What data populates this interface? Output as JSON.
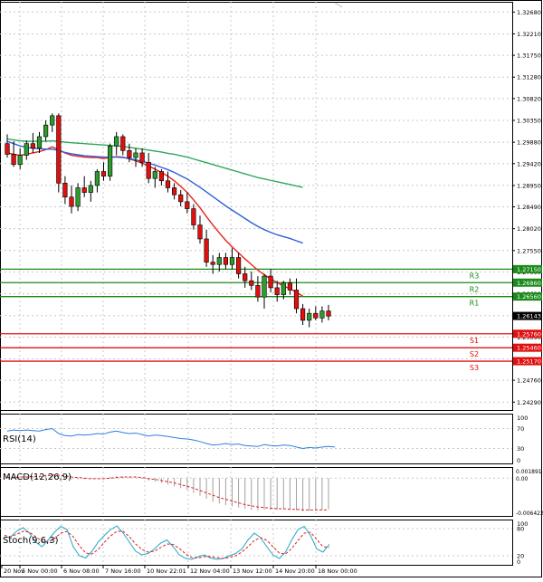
{
  "chart_data": [
    {
      "type": "candlestick",
      "symbol": "GBPUSD",
      "x_tick_labels": [
        "20 Nov",
        "5 Nov 00:00",
        "6 Nov 08:00",
        "7 Nov 16:00",
        "10 Nov 22:01",
        "12 Nov 04:00",
        "13 Nov 12:00",
        "14 Nov 20:00",
        "18 Nov 00:00"
      ],
      "y_tick_labels": [
        "1.32680",
        "1.32210",
        "1.31750",
        "1.31280",
        "1.30820",
        "1.30350",
        "1.29880",
        "1.29420",
        "1.28950",
        "1.28490",
        "1.28020",
        "1.27550",
        "1.27090",
        "1.26620",
        "1.26150",
        "1.25690",
        "1.25220",
        "1.24760",
        "1.24290"
      ],
      "ylim": [
        1.2412,
        1.329
      ],
      "current_price": "1.26143",
      "candles": [
        {
          "o": 1.2985,
          "h": 1.3005,
          "l": 1.2955,
          "c": 1.2962
        },
        {
          "o": 1.2962,
          "h": 1.299,
          "l": 1.2935,
          "c": 1.294
        },
        {
          "o": 1.294,
          "h": 1.2975,
          "l": 1.293,
          "c": 1.296
        },
        {
          "o": 1.296,
          "h": 1.2992,
          "l": 1.295,
          "c": 1.2985
        },
        {
          "o": 1.2985,
          "h": 1.3008,
          "l": 1.2965,
          "c": 1.2975
        },
        {
          "o": 1.2975,
          "h": 1.301,
          "l": 1.2965,
          "c": 1.3
        },
        {
          "o": 1.3,
          "h": 1.3035,
          "l": 1.299,
          "c": 1.3025
        },
        {
          "o": 1.3025,
          "h": 1.305,
          "l": 1.301,
          "c": 1.3045
        },
        {
          "o": 1.3045,
          "h": 1.305,
          "l": 1.288,
          "c": 1.29
        },
        {
          "o": 1.29,
          "h": 1.2915,
          "l": 1.2855,
          "c": 1.287
        },
        {
          "o": 1.287,
          "h": 1.2895,
          "l": 1.2835,
          "c": 1.285
        },
        {
          "o": 1.285,
          "h": 1.29,
          "l": 1.284,
          "c": 1.289
        },
        {
          "o": 1.289,
          "h": 1.2915,
          "l": 1.287,
          "c": 1.288
        },
        {
          "o": 1.288,
          "h": 1.2905,
          "l": 1.286,
          "c": 1.2895
        },
        {
          "o": 1.2895,
          "h": 1.293,
          "l": 1.288,
          "c": 1.2925
        },
        {
          "o": 1.2925,
          "h": 1.2945,
          "l": 1.2905,
          "c": 1.2915
        },
        {
          "o": 1.2915,
          "h": 1.2985,
          "l": 1.2905,
          "c": 1.298
        },
        {
          "o": 1.298,
          "h": 1.301,
          "l": 1.296,
          "c": 1.3
        },
        {
          "o": 1.3,
          "h": 1.3005,
          "l": 1.296,
          "c": 1.297
        },
        {
          "o": 1.297,
          "h": 1.2985,
          "l": 1.2945,
          "c": 1.2955
        },
        {
          "o": 1.2955,
          "h": 1.2975,
          "l": 1.2935,
          "c": 1.2965
        },
        {
          "o": 1.2965,
          "h": 1.2975,
          "l": 1.2935,
          "c": 1.2945
        },
        {
          "o": 1.2945,
          "h": 1.2965,
          "l": 1.29,
          "c": 1.291
        },
        {
          "o": 1.291,
          "h": 1.2935,
          "l": 1.289,
          "c": 1.2925
        },
        {
          "o": 1.2925,
          "h": 1.293,
          "l": 1.2895,
          "c": 1.2905
        },
        {
          "o": 1.2905,
          "h": 1.2925,
          "l": 1.288,
          "c": 1.289
        },
        {
          "o": 1.289,
          "h": 1.29,
          "l": 1.2865,
          "c": 1.2875
        },
        {
          "o": 1.2875,
          "h": 1.2885,
          "l": 1.285,
          "c": 1.286
        },
        {
          "o": 1.286,
          "h": 1.288,
          "l": 1.2835,
          "c": 1.2845
        },
        {
          "o": 1.2845,
          "h": 1.2855,
          "l": 1.28,
          "c": 1.281
        },
        {
          "o": 1.281,
          "h": 1.283,
          "l": 1.277,
          "c": 1.278
        },
        {
          "o": 1.278,
          "h": 1.28,
          "l": 1.272,
          "c": 1.273
        },
        {
          "o": 1.273,
          "h": 1.2745,
          "l": 1.2705,
          "c": 1.2725
        },
        {
          "o": 1.2725,
          "h": 1.275,
          "l": 1.271,
          "c": 1.274
        },
        {
          "o": 1.274,
          "h": 1.275,
          "l": 1.2715,
          "c": 1.2725
        },
        {
          "o": 1.2725,
          "h": 1.276,
          "l": 1.2715,
          "c": 1.274
        },
        {
          "o": 1.274,
          "h": 1.275,
          "l": 1.2695,
          "c": 1.2705
        },
        {
          "o": 1.2705,
          "h": 1.272,
          "l": 1.2675,
          "c": 1.269
        },
        {
          "o": 1.269,
          "h": 1.271,
          "l": 1.267,
          "c": 1.268
        },
        {
          "o": 1.268,
          "h": 1.27,
          "l": 1.2645,
          "c": 1.2655
        },
        {
          "o": 1.2655,
          "h": 1.2705,
          "l": 1.263,
          "c": 1.27
        },
        {
          "o": 1.27,
          "h": 1.2715,
          "l": 1.2665,
          "c": 1.2675
        },
        {
          "o": 1.2675,
          "h": 1.269,
          "l": 1.2645,
          "c": 1.266
        },
        {
          "o": 1.266,
          "h": 1.269,
          "l": 1.265,
          "c": 1.2685
        },
        {
          "o": 1.2685,
          "h": 1.2695,
          "l": 1.266,
          "c": 1.267
        },
        {
          "o": 1.267,
          "h": 1.2695,
          "l": 1.262,
          "c": 1.263
        },
        {
          "o": 1.263,
          "h": 1.264,
          "l": 1.2595,
          "c": 1.2605
        },
        {
          "o": 1.2605,
          "h": 1.263,
          "l": 1.259,
          "c": 1.262
        },
        {
          "o": 1.262,
          "h": 1.2635,
          "l": 1.2605,
          "c": 1.261
        },
        {
          "o": 1.261,
          "h": 1.2635,
          "l": 1.26,
          "c": 1.2625
        },
        {
          "o": 1.2625,
          "h": 1.2638,
          "l": 1.2605,
          "c": 1.2614
        }
      ],
      "moving_averages": [
        {
          "color": "#e8231c",
          "points": [
            1.2965,
            1.2962,
            1.296,
            1.2962,
            1.2965,
            1.2968,
            1.2972,
            1.2978,
            1.2972,
            1.2965,
            1.296,
            1.2958,
            1.2956,
            1.2955,
            1.2955,
            1.2953,
            1.2955,
            1.2957,
            1.2956,
            1.2952,
            1.2948,
            1.2943,
            1.2937,
            1.293,
            1.2923,
            1.2915,
            1.2905,
            1.2893,
            1.288,
            1.2864,
            1.2847,
            1.2828,
            1.281,
            1.2793,
            1.2777,
            1.2763,
            1.275,
            1.2737,
            1.2725,
            1.2713,
            1.2703,
            1.2694,
            1.2686,
            1.2679,
            1.2673,
            1.2665,
            1.2657
          ]
        },
        {
          "color": "#3060d8",
          "points": [
            1.299,
            1.2985,
            1.298,
            1.2977,
            1.2975,
            1.2974,
            1.2973,
            1.2973,
            1.297,
            1.2966,
            1.2963,
            1.2961,
            1.2959,
            1.2958,
            1.2957,
            1.2956,
            1.2956,
            1.2956,
            1.2955,
            1.2953,
            1.295,
            1.2947,
            1.2943,
            1.2939,
            1.2934,
            1.2929,
            1.2923,
            1.2916,
            1.2909,
            1.29,
            1.2891,
            1.2881,
            1.2871,
            1.2861,
            1.2851,
            1.2842,
            1.2833,
            1.2824,
            1.2815,
            1.2807,
            1.28,
            1.2794,
            1.2789,
            1.2785,
            1.2781,
            1.2776,
            1.2771
          ]
        },
        {
          "color": "#2fa85a",
          "points": [
            1.2995,
            1.2993,
            1.2991,
            1.299,
            1.299,
            1.299,
            1.299,
            1.2991,
            1.299,
            1.2988,
            1.2987,
            1.2986,
            1.2985,
            1.2984,
            1.2983,
            1.2982,
            1.2981,
            1.298,
            1.2979,
            1.2977,
            1.2975,
            1.2973,
            1.2971,
            1.2969,
            1.2967,
            1.2964,
            1.2962,
            1.2959,
            1.2956,
            1.2952,
            1.2948,
            1.2944,
            1.294,
            1.2936,
            1.2932,
            1.2928,
            1.2924,
            1.292,
            1.2916,
            1.2912,
            1.2909,
            1.2906,
            1.2903,
            1.29,
            1.2897,
            1.2894,
            1.2891
          ]
        }
      ],
      "levels": [
        {
          "name": "R3",
          "value": 1.2715,
          "label": "1.27150",
          "color": "#1a8a1a"
        },
        {
          "name": "R2",
          "value": 1.2686,
          "label": "1.26860",
          "color": "#1a8a1a"
        },
        {
          "name": "R1",
          "value": 1.2656,
          "label": "1.26560",
          "color": "#1a8a1a"
        },
        {
          "name": "S1",
          "value": 1.2576,
          "label": "1.25760",
          "color": "#e01010"
        },
        {
          "name": "S2",
          "value": 1.2546,
          "label": "1.25460",
          "color": "#e01010"
        },
        {
          "name": "S3",
          "value": 1.2517,
          "label": "1.25170",
          "color": "#e01010"
        }
      ]
    },
    {
      "type": "line",
      "title": "RSI(14)",
      "y_tick_labels": [
        "100",
        "70",
        "30",
        "0"
      ],
      "ylim": [
        0,
        100
      ],
      "levels": [
        70,
        30
      ],
      "values": [
        65,
        67,
        66,
        67,
        66,
        65,
        68,
        70,
        60,
        56,
        55,
        58,
        57,
        58,
        60,
        59,
        63,
        65,
        62,
        60,
        61,
        58,
        55,
        57,
        56,
        54,
        52,
        50,
        49,
        47,
        44,
        40,
        37,
        38,
        40,
        38,
        39,
        36,
        35,
        34,
        38,
        36,
        35,
        37,
        36,
        33,
        30,
        32,
        31,
        33,
        34,
        33
      ]
    },
    {
      "type": "histogram",
      "title": "MACD(12,26,9)",
      "y_tick_labels": [
        "0.001891",
        "0.00",
        "-0.006422"
      ],
      "ylim": [
        -0.006422,
        0.001891
      ],
      "histogram": [
        0.0004,
        0.0003,
        0.0002,
        0.0002,
        0.0003,
        0.0004,
        0.0006,
        0.0008,
        0.0004,
        0.0,
        -0.0002,
        -0.0002,
        -0.0002,
        -0.0001,
        0.0,
        0.0,
        0.0002,
        0.0004,
        0.0003,
        0.0002,
        0.0001,
        -0.0001,
        -0.0004,
        -0.0006,
        -0.0008,
        -0.0011,
        -0.0014,
        -0.0017,
        -0.002,
        -0.0025,
        -0.003,
        -0.0035,
        -0.004,
        -0.0043,
        -0.0046,
        -0.0048,
        -0.005,
        -0.0052,
        -0.0054,
        -0.0055,
        -0.0054,
        -0.0054,
        -0.0054,
        -0.0053,
        -0.0053,
        -0.0055,
        -0.0056,
        -0.0056,
        -0.0055,
        -0.0054,
        -0.0053
      ],
      "signal": [
        0.0001,
        0.0001,
        0.0002,
        0.0002,
        0.0003,
        0.0003,
        0.0004,
        0.0005,
        0.0005,
        0.0004,
        0.0002,
        0.0001,
        0.0,
        -0.0001,
        -0.0001,
        -0.0001,
        0.0,
        0.0001,
        0.0002,
        0.0002,
        0.0002,
        0.0001,
        -0.0001,
        -0.0002,
        -0.0004,
        -0.0006,
        -0.0008,
        -0.0011,
        -0.0014,
        -0.0017,
        -0.0021,
        -0.0025,
        -0.0029,
        -0.0033,
        -0.0036,
        -0.0039,
        -0.0042,
        -0.0045,
        -0.0047,
        -0.0049,
        -0.005,
        -0.0051,
        -0.0052,
        -0.0052,
        -0.0053,
        -0.0053,
        -0.0054,
        -0.0054,
        -0.0054,
        -0.0054,
        -0.0054
      ]
    },
    {
      "type": "line",
      "title": "Stoch(9,6,3)",
      "y_tick_labels": [
        "100",
        "80",
        "20",
        "0"
      ],
      "ylim": [
        0,
        100
      ],
      "levels": [
        80,
        20
      ],
      "series": [
        {
          "color": "#1fa8c8",
          "values": [
            60,
            62,
            75,
            82,
            70,
            50,
            40,
            55,
            72,
            85,
            78,
            40,
            20,
            15,
            30,
            50,
            65,
            78,
            86,
            70,
            50,
            30,
            22,
            25,
            35,
            48,
            55,
            40,
            22,
            14,
            12,
            18,
            22,
            15,
            12,
            14,
            20,
            25,
            35,
            55,
            70,
            60,
            40,
            22,
            14,
            28,
            55,
            78,
            85,
            65,
            35,
            28,
            45
          ]
        },
        {
          "color": "#e02020",
          "values": [
            65,
            62,
            68,
            74,
            72,
            62,
            52,
            50,
            58,
            70,
            74,
            62,
            42,
            26,
            24,
            34,
            50,
            64,
            74,
            74,
            62,
            46,
            34,
            28,
            30,
            38,
            46,
            45,
            36,
            24,
            16,
            15,
            18,
            18,
            16,
            14,
            16,
            20,
            28,
            40,
            54,
            60,
            54,
            40,
            26,
            24,
            36,
            54,
            70,
            72,
            56,
            40,
            38
          ]
        }
      ]
    }
  ]
}
